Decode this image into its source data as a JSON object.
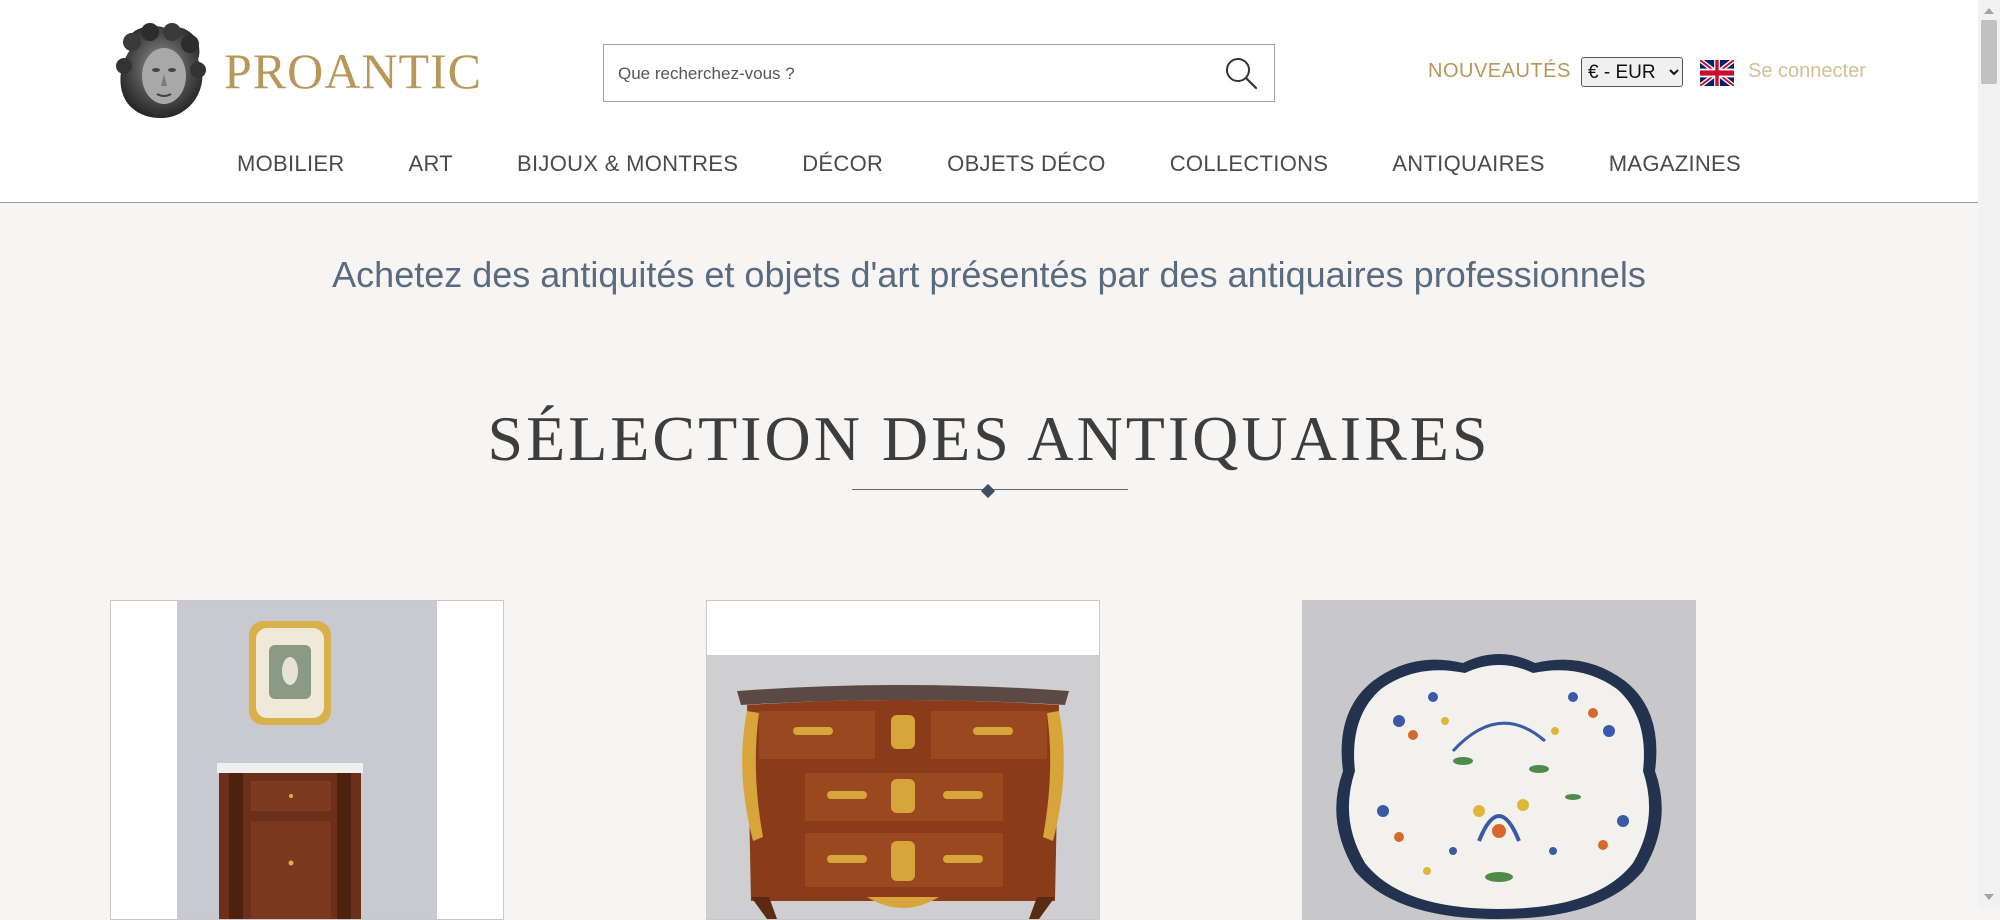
{
  "header": {
    "logo_text": "PROANTIC",
    "search": {
      "placeholder": "Que recherchez-vous ?",
      "value": ""
    },
    "nouveautes_label": "NOUVEAUTÉS",
    "currency": {
      "selected": "€ - EUR",
      "options": [
        "€ - EUR"
      ]
    },
    "language_flag": "uk-flag-icon",
    "login_label": "Se connecter"
  },
  "nav": {
    "items": [
      {
        "label": "MOBILIER"
      },
      {
        "label": "ART"
      },
      {
        "label": "BIJOUX & MONTRES"
      },
      {
        "label": "DÉCOR"
      },
      {
        "label": "OBJETS DÉCO"
      },
      {
        "label": "COLLECTIONS"
      },
      {
        "label": "ANTIQUAIRES"
      },
      {
        "label": "MAGAZINES"
      }
    ]
  },
  "main": {
    "tagline": "Achetez des antiquités et objets d'art présentés par des antiquaires professionnels",
    "section_title": "SÉLECTION DES ANTIQUAIRES",
    "cards": [
      {
        "image": "mahogany-demilune-cabinet-with-framed-miniature"
      },
      {
        "image": "louis-xv-marquetry-commode-with-ormolu-mounts"
      },
      {
        "image": "polychrome-faience-platter"
      }
    ]
  },
  "colors": {
    "brand_gold": "#b8975a",
    "login_gold": "#d2bf96",
    "tagline_blue": "#5a6b80",
    "page_bg": "#f6f5f3"
  }
}
